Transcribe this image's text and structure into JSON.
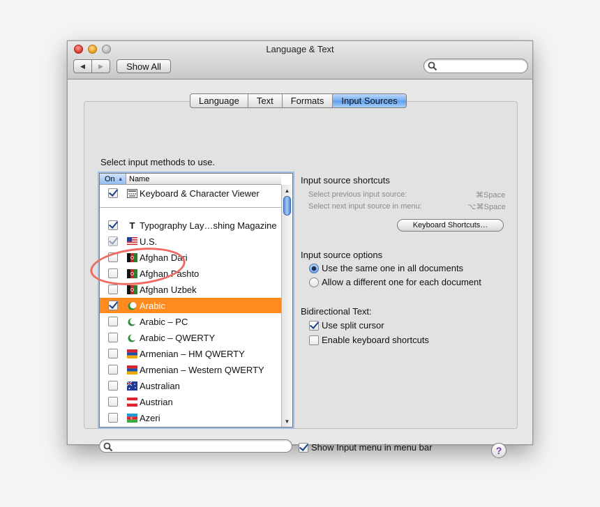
{
  "window": {
    "title": "Language & Text",
    "back_arrow": "◀",
    "forward_arrow": "▶",
    "show_all_label": "Show All",
    "search_placeholder": ""
  },
  "tabs": [
    {
      "label": "Language",
      "active": false
    },
    {
      "label": "Text",
      "active": false
    },
    {
      "label": "Formats",
      "active": false
    },
    {
      "label": "Input Sources",
      "active": true
    }
  ],
  "input_sources": {
    "prompt": "Select input methods to use.",
    "columns": {
      "on": "On",
      "sort_arrow": "▲",
      "name": "Name"
    },
    "scroll_up": "▲",
    "scroll_down": "▼",
    "items": [
      {
        "label": "Keyboard & Character Viewer",
        "checked": true,
        "enabled": true,
        "flag": "keyboard-viewer-icon"
      },
      {
        "label": "Typography Lay…shing Magazine",
        "checked": true,
        "enabled": true,
        "flag": "typography-icon",
        "glyph": "T"
      },
      {
        "label": "U.S.",
        "checked": true,
        "enabled": false,
        "flag": "us-flag-icon"
      },
      {
        "label": "Afghan Dari",
        "checked": false,
        "enabled": true,
        "flag": "afghan-flag-icon"
      },
      {
        "label": "Afghan Pashto",
        "checked": false,
        "enabled": true,
        "flag": "afghan-flag-icon"
      },
      {
        "label": "Afghan Uzbek",
        "checked": false,
        "enabled": true,
        "flag": "afghan-flag-icon"
      },
      {
        "label": "Arabic",
        "checked": true,
        "enabled": true,
        "selected": true,
        "flag": "arabic-crescent-icon"
      },
      {
        "label": "Arabic – PC",
        "checked": false,
        "enabled": true,
        "flag": "arabic-crescent-icon"
      },
      {
        "label": "Arabic – QWERTY",
        "checked": false,
        "enabled": true,
        "flag": "arabic-crescent-icon"
      },
      {
        "label": "Armenian – HM QWERTY",
        "checked": false,
        "enabled": true,
        "flag": "armenian-flag-icon"
      },
      {
        "label": "Armenian – Western QWERTY",
        "checked": false,
        "enabled": true,
        "flag": "armenian-flag-icon"
      },
      {
        "label": "Australian",
        "checked": false,
        "enabled": true,
        "flag": "australian-flag-icon"
      },
      {
        "label": "Austrian",
        "checked": false,
        "enabled": true,
        "flag": "austrian-flag-icon"
      },
      {
        "label": "Azeri",
        "checked": false,
        "enabled": true,
        "flag": "azeri-flag-icon"
      }
    ]
  },
  "shortcuts": {
    "heading": "Input source shortcuts",
    "prev_label": "Select previous input source:",
    "prev_keys": "⌘Space",
    "next_label": "Select next input source in menu:",
    "next_keys": "⌥⌘Space",
    "button_label": "Keyboard Shortcuts…"
  },
  "options": {
    "heading": "Input source options",
    "same_label": "Use the same one in all documents",
    "same_selected": true,
    "different_label": "Allow a different one for each document"
  },
  "bidi": {
    "heading": "Bidirectional Text:",
    "split_cursor_label": "Use split cursor",
    "split_cursor_checked": true,
    "kbd_shortcuts_label": "Enable keyboard shortcuts",
    "kbd_shortcuts_checked": false
  },
  "footer": {
    "show_menu_label": "Show Input menu in menu bar",
    "show_menu_checked": true,
    "help_label": "?"
  },
  "colors": {
    "selection": "#ff8a1e",
    "annotation": "#ee6a62",
    "accent": "#5b9cef"
  }
}
